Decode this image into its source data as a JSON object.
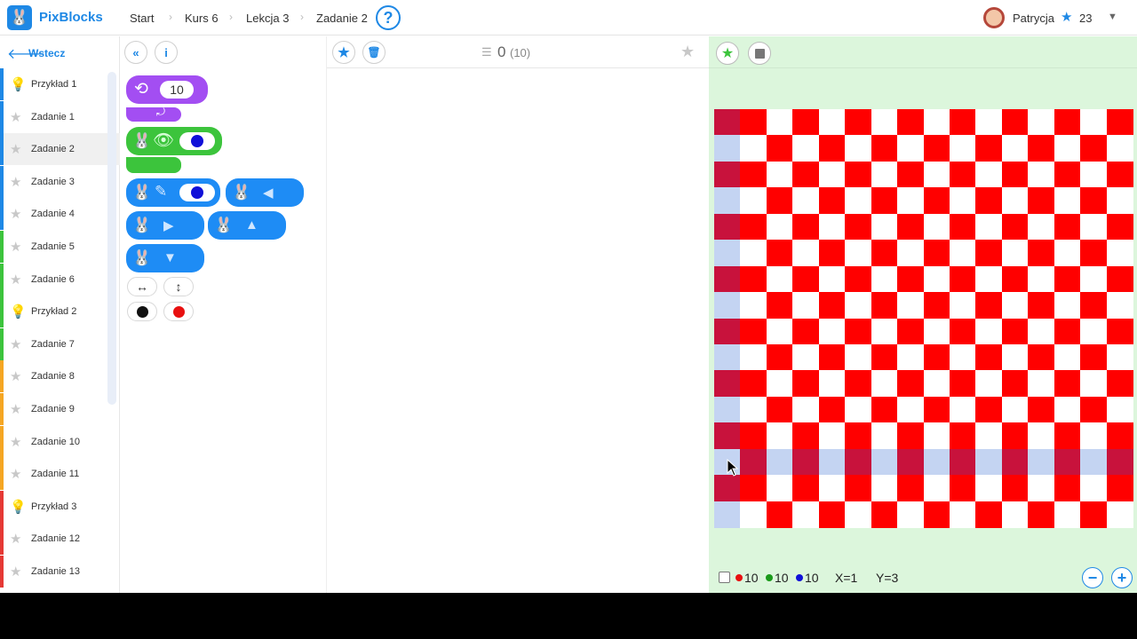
{
  "app": {
    "name": "PixBlocks",
    "logo_icon": "bunny-icon"
  },
  "breadcrumb": {
    "items": [
      "Start",
      "Kurs 6",
      "Lekcja 3",
      "Zadanie 2"
    ],
    "help": "?"
  },
  "user": {
    "name": "Patrycja",
    "score": "23"
  },
  "sidebar": {
    "back_label": "Wstecz",
    "items": [
      {
        "label": "Przykład 1",
        "type": "example",
        "bar_color": "#1e88e5"
      },
      {
        "label": "Zadanie 1",
        "type": "task",
        "bar_color": "#1e88e5"
      },
      {
        "label": "Zadanie 2",
        "type": "task",
        "bar_color": "#1e88e5",
        "active": true
      },
      {
        "label": "Zadanie 3",
        "type": "task",
        "bar_color": "#1e88e5"
      },
      {
        "label": "Zadanie 4",
        "type": "task",
        "bar_color": "#1e88e5"
      },
      {
        "label": "Zadanie 5",
        "type": "task",
        "bar_color": "#3cc43c"
      },
      {
        "label": "Zadanie 6",
        "type": "task",
        "bar_color": "#3cc43c"
      },
      {
        "label": "Przykład 2",
        "type": "example",
        "bar_color": "#3cc43c"
      },
      {
        "label": "Zadanie 7",
        "type": "task",
        "bar_color": "#3cc43c"
      },
      {
        "label": "Zadanie 8",
        "type": "task",
        "bar_color": "#f5a623"
      },
      {
        "label": "Zadanie 9",
        "type": "task",
        "bar_color": "#f5a623"
      },
      {
        "label": "Zadanie 10",
        "type": "task",
        "bar_color": "#f5a623"
      },
      {
        "label": "Zadanie 11",
        "type": "task",
        "bar_color": "#f5a623"
      },
      {
        "label": "Przykład 3",
        "type": "example",
        "bar_color": "#e53935"
      },
      {
        "label": "Zadanie 12",
        "type": "task",
        "bar_color": "#e53935"
      },
      {
        "label": "Zadanie 13",
        "type": "task",
        "bar_color": "#e53935"
      }
    ]
  },
  "toolbox": {
    "repeat_count": "10",
    "colors": {
      "purple": "#a34ef2",
      "green": "#3cc43c",
      "blue": "#1e8cf5",
      "dot_blue": "#1010d8",
      "dot_black": "#111111",
      "dot_red": "#e81010"
    }
  },
  "code": {
    "count": "0",
    "limit": "(10)"
  },
  "board": {
    "rows": 16,
    "cols": 16,
    "colors": {
      "red": "#ff0000",
      "white": "#ffffff",
      "dark_red": "#c8123c",
      "light_blue": "#c4d4f2"
    },
    "highlight_row": 13,
    "highlight_col": 0
  },
  "footer": {
    "red_count": "10",
    "green_count": "10",
    "blue_count": "10",
    "x_label": "X=1",
    "y_label": "Y=3"
  }
}
